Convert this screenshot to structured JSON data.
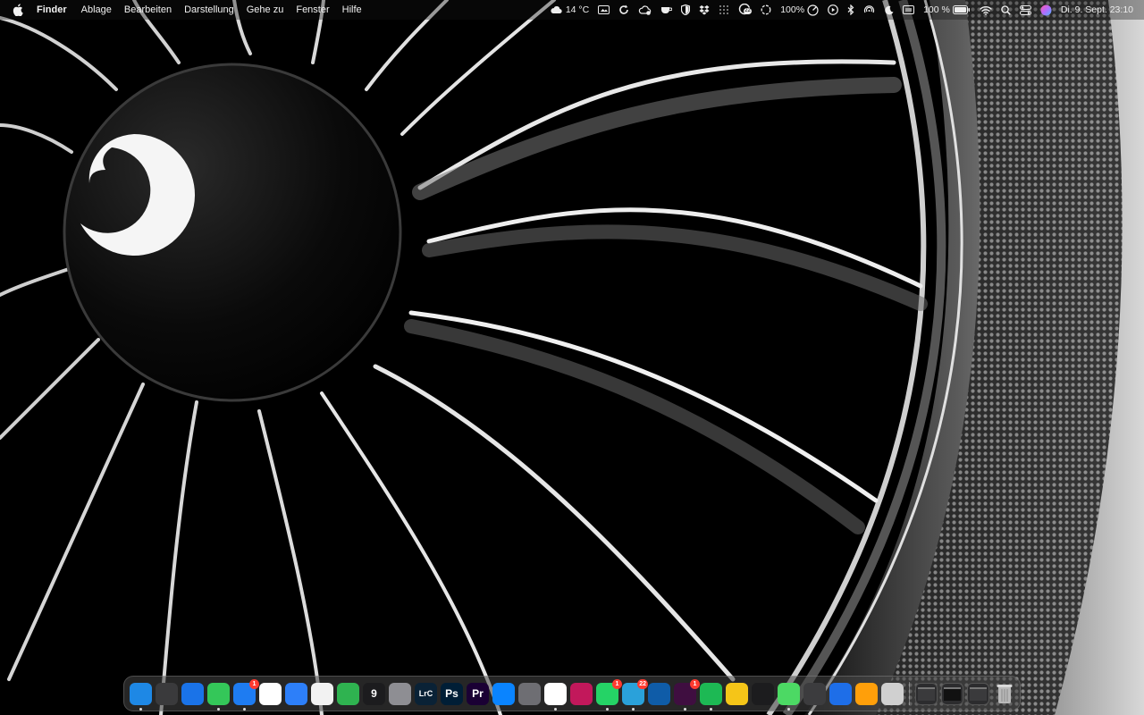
{
  "menubar": {
    "app_name": "Finder",
    "menus": [
      "Ablage",
      "Bearbeiten",
      "Darstellung",
      "Gehe zu",
      "Fenster",
      "Hilfe"
    ],
    "status": {
      "weather": "14 °C",
      "cpu_percent": "100%",
      "battery": "100 %",
      "datetime": "Di. 9. Sept. 23:10",
      "notification_count": "22"
    }
  },
  "dock": {
    "apps": [
      {
        "name": "Finder",
        "icon": "finder-icon",
        "color": "#1e88e5",
        "glyph": "",
        "running": true
      },
      {
        "name": "Launchpad",
        "icon": "launchpad-icon",
        "color": "#3a3a3c",
        "glyph": "",
        "running": false
      },
      {
        "name": "Safari",
        "icon": "safari-icon",
        "color": "#1a73e8",
        "glyph": "",
        "running": false
      },
      {
        "name": "Nachrichten",
        "icon": "messages-icon",
        "color": "#34c759",
        "glyph": "",
        "running": true
      },
      {
        "name": "Mail",
        "icon": "mail-icon",
        "color": "#1e7cf2",
        "glyph": "",
        "running": true,
        "badge": "1"
      },
      {
        "name": "Kalender",
        "icon": "calendar-icon",
        "color": "#ffffff",
        "glyph": "",
        "running": false
      },
      {
        "name": "App Store",
        "icon": "app-store-icon",
        "color": "#2d7ff9",
        "glyph": "",
        "running": false
      },
      {
        "name": "Fotos",
        "icon": "photos-icon",
        "color": "#f2f2f2",
        "glyph": "",
        "running": false
      },
      {
        "name": "FaceTime",
        "icon": "facetime-icon",
        "color": "#2fb350",
        "glyph": "",
        "running": false
      },
      {
        "name": "Uhr",
        "icon": "clock-icon",
        "color": "#1c1c1e",
        "glyph": "9",
        "running": false
      },
      {
        "name": "Kontakte",
        "icon": "contacts-icon",
        "color": "#8e8e93",
        "glyph": "",
        "running": false
      },
      {
        "name": "Lightroom Classic",
        "icon": "lightroom-icon",
        "color": "#0a2236",
        "glyph": "LrC",
        "running": false
      },
      {
        "name": "Photoshop",
        "icon": "photoshop-icon",
        "color": "#001e36",
        "glyph": "Ps",
        "running": false
      },
      {
        "name": "Premiere Pro",
        "icon": "premiere-icon",
        "color": "#1a0034",
        "glyph": "Pr",
        "running": false
      },
      {
        "name": "Instruments",
        "icon": "instruments-icon",
        "color": "#0a84ff",
        "glyph": "",
        "running": false
      },
      {
        "name": "Systemeinstellungen",
        "icon": "settings-icon",
        "color": "#6e6e73",
        "glyph": "",
        "running": false
      },
      {
        "name": "ChatGPT",
        "icon": "chatgpt-icon",
        "color": "#ffffff",
        "glyph": "",
        "running": true
      },
      {
        "name": "Kurzbefehle",
        "icon": "shortcuts-icon",
        "color": "#c2185b",
        "glyph": "",
        "running": false
      },
      {
        "name": "WhatsApp",
        "icon": "whatsapp-icon",
        "color": "#25d366",
        "glyph": "",
        "running": true,
        "badge": "1"
      },
      {
        "name": "Telegram",
        "icon": "telegram-icon",
        "color": "#2aa1da",
        "glyph": "",
        "running": true,
        "badge": "22"
      },
      {
        "name": "Visual Studio Code",
        "icon": "vscode-icon",
        "color": "#0f5ca8",
        "glyph": "",
        "running": false
      },
      {
        "name": "Slack",
        "icon": "slack-icon",
        "color": "#3f0e40",
        "glyph": "",
        "running": true,
        "badge": "1"
      },
      {
        "name": "Spotify",
        "icon": "spotify-icon",
        "color": "#1db954",
        "glyph": "",
        "running": true
      },
      {
        "name": "Notizen",
        "icon": "notes-icon",
        "color": "#f5c518",
        "glyph": "",
        "running": false
      },
      {
        "name": "Terminal",
        "icon": "terminal-icon",
        "color": "#1c1c1e",
        "glyph": "",
        "running": false
      },
      {
        "name": "Karten",
        "icon": "maps-icon",
        "color": "#4cd964",
        "glyph": "",
        "running": true
      },
      {
        "name": "Bitwarden",
        "icon": "bitwarden-icon",
        "color": "#3c3c3e",
        "glyph": "",
        "running": false
      },
      {
        "name": "Sync",
        "icon": "sync-icon",
        "color": "#1e6ee8",
        "glyph": "",
        "running": false
      },
      {
        "name": "Home",
        "icon": "home-icon",
        "color": "#ff9f0a",
        "glyph": "",
        "running": false
      },
      {
        "name": "Robot",
        "icon": "robot-icon",
        "color": "#d0d0d0",
        "glyph": "",
        "running": false
      }
    ],
    "minimized": [
      {
        "name": "Fenster 1",
        "icon": "window-thumbnail-icon"
      },
      {
        "name": "Fenster 2",
        "icon": "window-thumbnail-icon"
      },
      {
        "name": "Fenster 3",
        "icon": "window-thumbnail-icon"
      }
    ],
    "trash": {
      "name": "Papierkorb",
      "icon": "trash-icon"
    }
  },
  "wallpaper": {
    "subject": "jet-engine-fan-icon"
  },
  "colors": {
    "menubar_text": "#f2f2f2",
    "badge": "#ff3b30",
    "dock_bg": "#464646"
  }
}
